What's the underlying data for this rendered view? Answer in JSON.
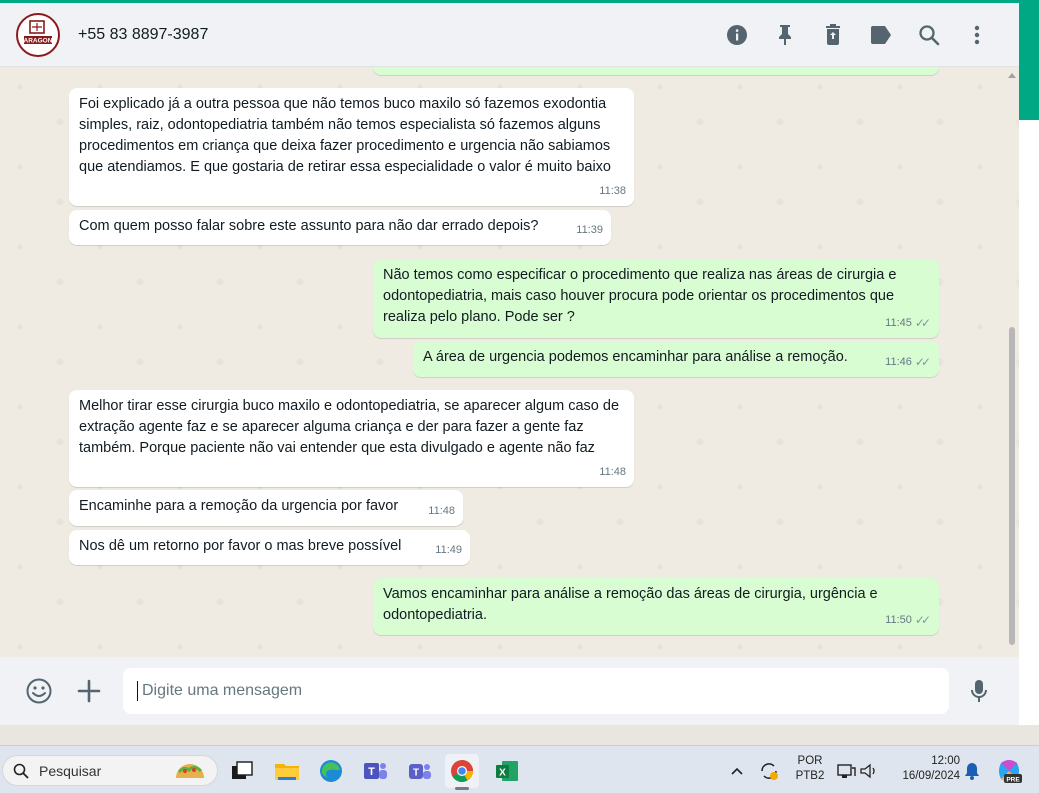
{
  "header": {
    "contact_name": "+55 83 8897-3987",
    "avatar_text": "ARAGON",
    "icons": [
      "info-icon",
      "pin-icon",
      "delete-icon",
      "label-icon",
      "search-icon",
      "menu-icon"
    ]
  },
  "messages": [
    {
      "dir": "in",
      "text": "Foi explicado já a outra pessoa que não temos buco maxilo só fazemos exodontia simples, raiz, odontopediatria também não temos especialista só fazemos alguns procedimentos em criança que deixa fazer procedimento e urgencia não sabiamos que atendiamos. E que gostaria de retirar essa especialidade o valor é muito baixo",
      "time": "11:38"
    },
    {
      "dir": "in",
      "text": "Com quem posso falar sobre este assunto para não dar errado depois?",
      "time": "11:39"
    },
    {
      "dir": "out",
      "text": "Não temos como especificar o procedimento que realiza nas áreas de cirurgia e odontopediatria, mais caso houver procura pode orientar os procedimentos que realiza pelo plano. Pode ser ?",
      "time": "11:45"
    },
    {
      "dir": "out",
      "text": "A área de urgencia podemos encaminhar para análise a remoção.",
      "time": "11:46"
    },
    {
      "dir": "in",
      "text": "Melhor tirar esse cirurgia buco maxilo e odontopediatria, se aparecer algum caso de extração agente faz e se aparecer alguma criança e der para fazer a gente faz também. Porque paciente não vai entender que esta divulgado e agente não faz",
      "time": "11:48"
    },
    {
      "dir": "in",
      "text": "Encaminhe para a remoção da urgencia por favor",
      "time": "11:48"
    },
    {
      "dir": "in",
      "text": "Nos dê um retorno por favor o mas breve possível",
      "time": "11:49"
    },
    {
      "dir": "out",
      "text": "Vamos encaminhar para análise a remoção das áreas de cirurgia, urgência e odontopediatria.",
      "time": "11:50"
    }
  ],
  "composer": {
    "placeholder": "Digite uma mensagem"
  },
  "taskbar": {
    "search_label": "Pesquisar",
    "lang_line1": "POR",
    "lang_line2": "PTB2",
    "time": "12:00",
    "date": "16/09/2024",
    "copilot_badge": "PRE"
  }
}
